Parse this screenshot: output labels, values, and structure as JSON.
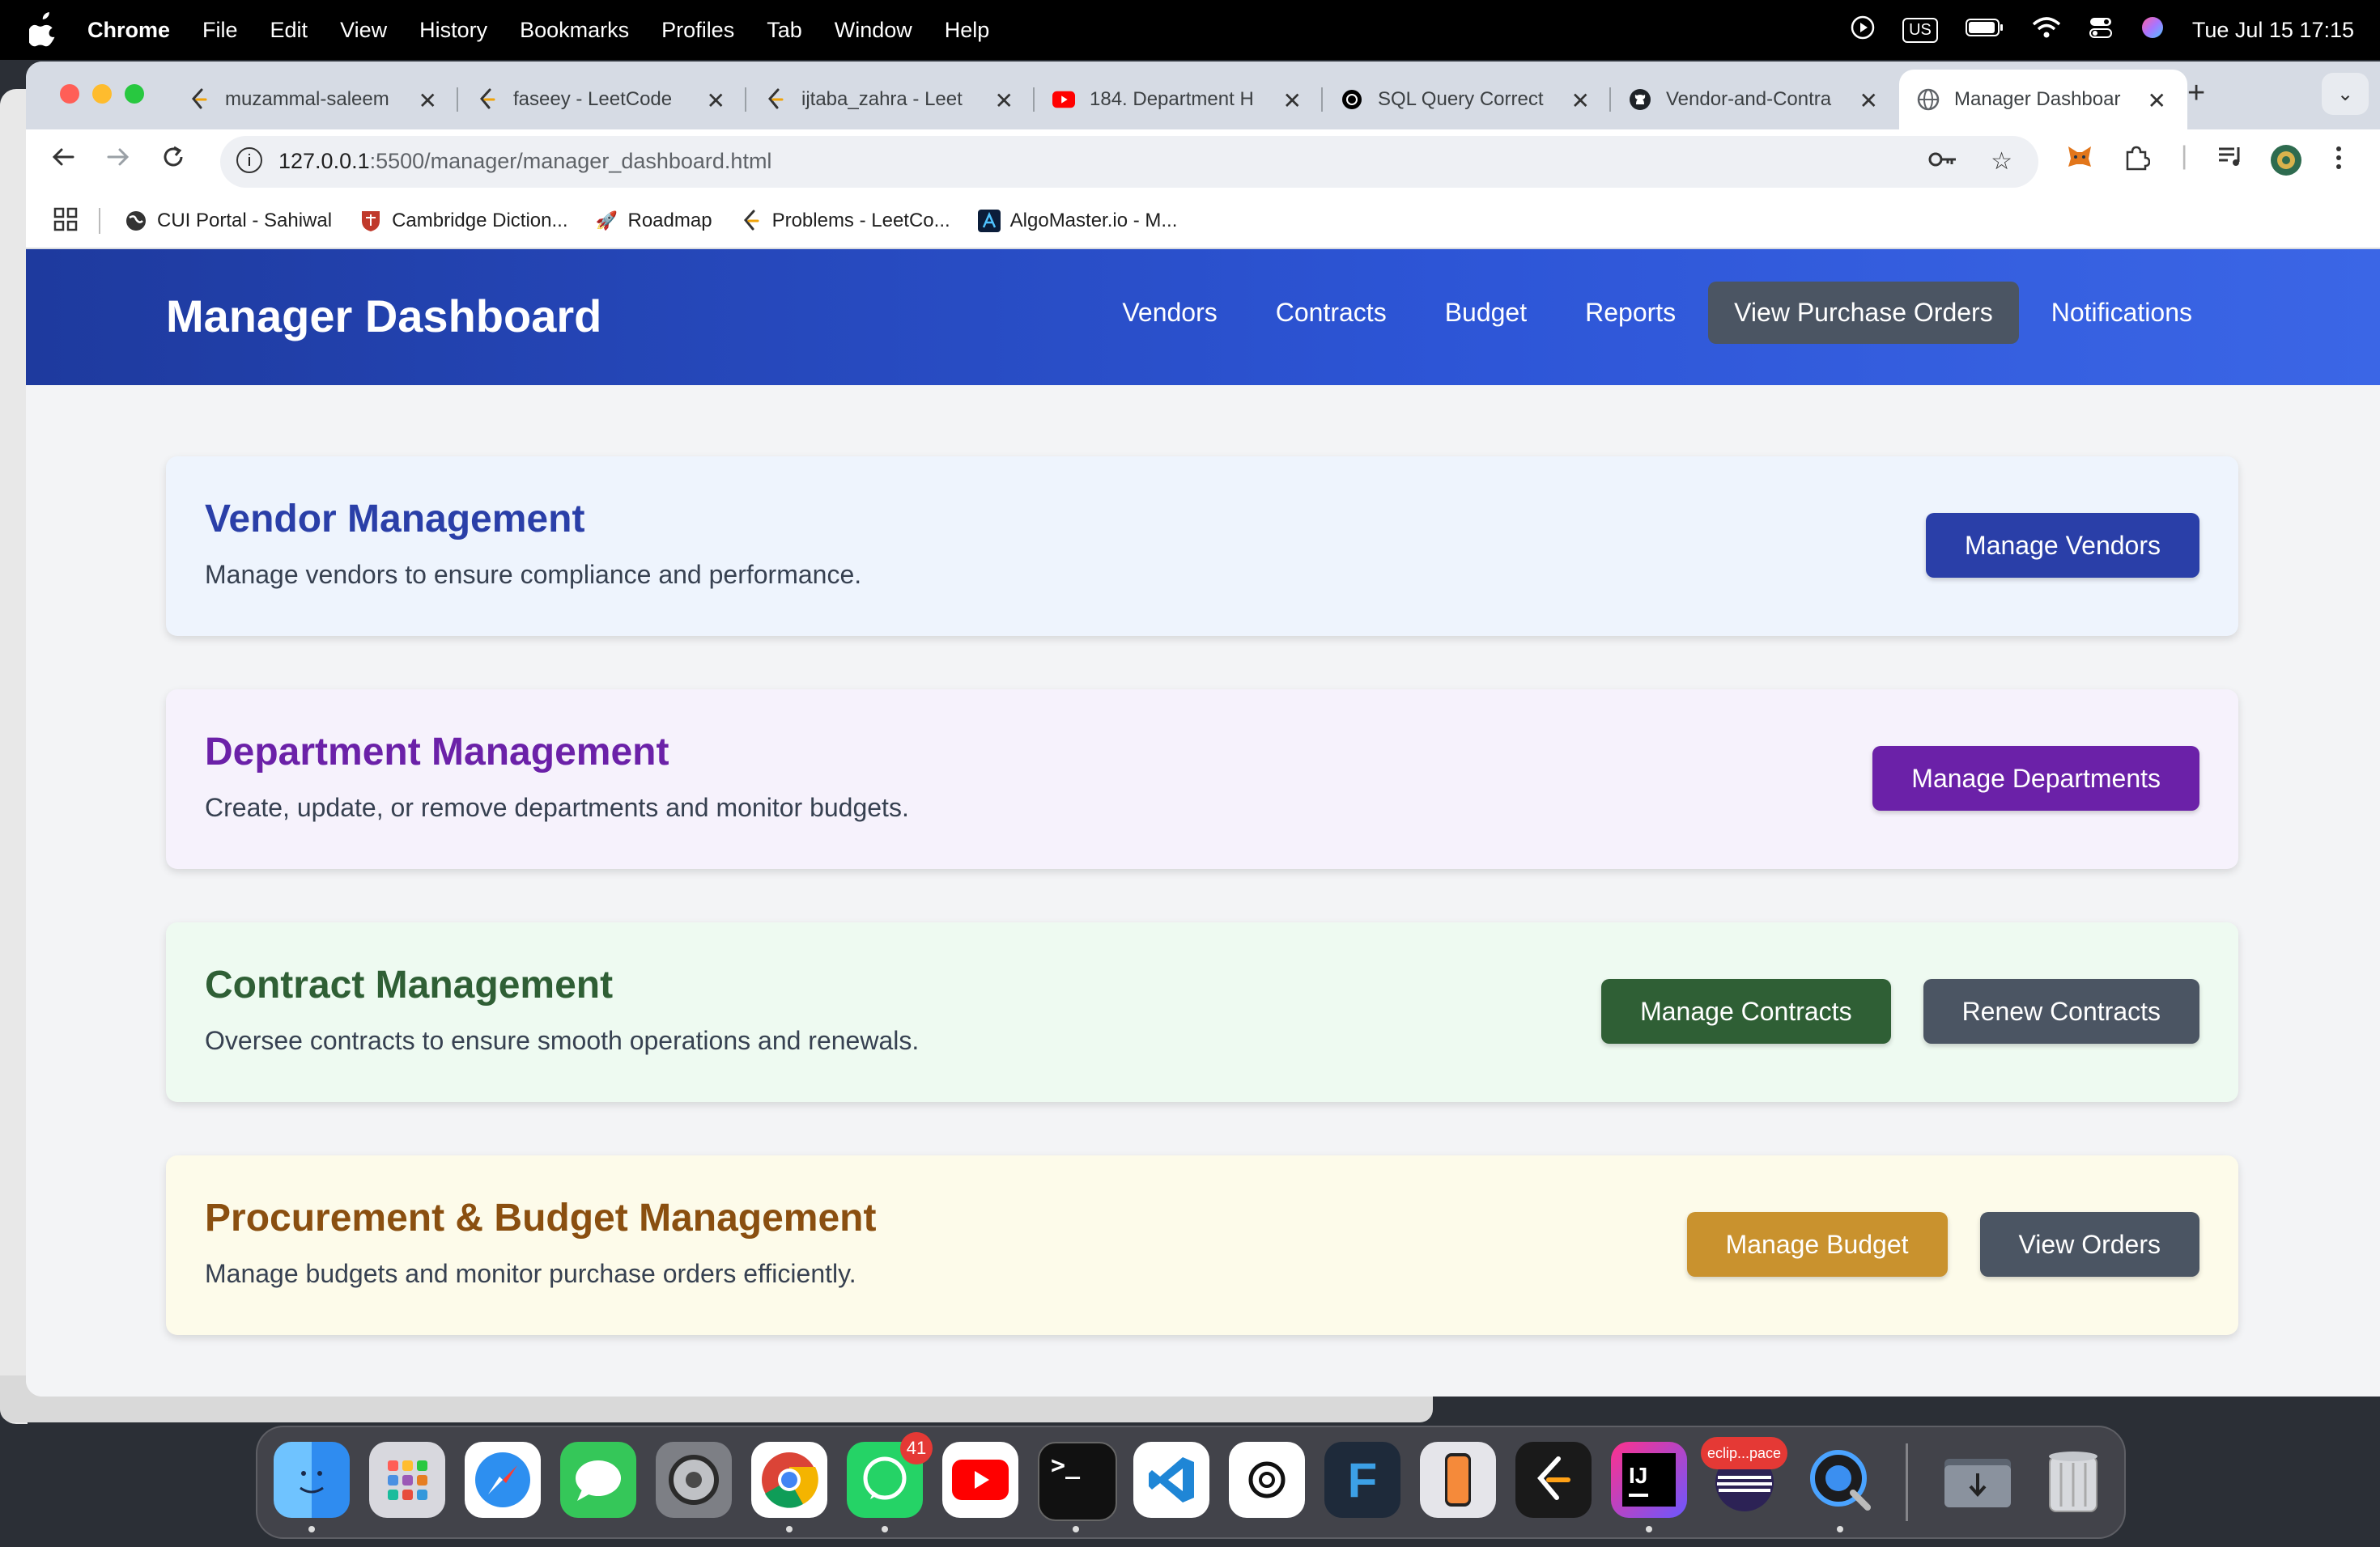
{
  "menubar": {
    "app_name": "Chrome",
    "menus": [
      "File",
      "Edit",
      "View",
      "History",
      "Bookmarks",
      "Profiles",
      "Tab",
      "Window",
      "Help"
    ],
    "input_source": "US",
    "clock": "Tue Jul 15  17:15"
  },
  "browser": {
    "tabs": [
      {
        "title": "muzammal-saleem",
        "icon": "leetcode-icon"
      },
      {
        "title": "faseey - LeetCode",
        "icon": "leetcode-icon"
      },
      {
        "title": "ijtaba_zahra - Leet",
        "icon": "leetcode-icon"
      },
      {
        "title": "184. Department H",
        "icon": "youtube-icon"
      },
      {
        "title": "SQL Query Correct",
        "icon": "chatgpt-icon"
      },
      {
        "title": "Vendor-and-Contra",
        "icon": "github-icon"
      },
      {
        "title": "Manager Dashboar",
        "icon": "globe-icon"
      }
    ],
    "active_tab_index": 6,
    "url_host": "127.0.0.1",
    "url_rest": ":5500/manager/manager_dashboard.html",
    "bookmarks": [
      {
        "label": "CUI Portal - Sahiwal",
        "icon": "globe-icon"
      },
      {
        "label": "Cambridge Diction...",
        "icon": "cambridge-icon"
      },
      {
        "label": "Roadmap",
        "icon": "rocket-icon"
      },
      {
        "label": "Problems - LeetCo...",
        "icon": "leetcode-icon"
      },
      {
        "label": "AlgoMaster.io - M...",
        "icon": "algomaster-icon"
      }
    ]
  },
  "page": {
    "brand": "Manager Dashboard",
    "nav": [
      "Vendors",
      "Contracts",
      "Budget",
      "Reports",
      "View Purchase Orders",
      "Notifications"
    ],
    "active_nav": "View Purchase Orders",
    "cards": [
      {
        "title": "Vendor Management",
        "description": "Manage vendors to ensure compliance and performance.",
        "bg": "#eef4fd",
        "title_color": "#2a3fa8",
        "buttons": [
          {
            "label": "Manage Vendors",
            "color": "#2a3fa8"
          }
        ]
      },
      {
        "title": "Department Management",
        "description": "Create, update, or remove departments and monitor budgets.",
        "bg": "#f6f2fc",
        "title_color": "#6b21a8",
        "buttons": [
          {
            "label": "Manage Departments",
            "color": "#6b21a8"
          }
        ]
      },
      {
        "title": "Contract Management",
        "description": "Oversee contracts to ensure smooth operations and renewals.",
        "bg": "#eefaf1",
        "title_color": "#2f5f35",
        "buttons": [
          {
            "label": "Manage Contracts",
            "color": "#2f5f35"
          },
          {
            "label": "Renew Contracts",
            "color": "#4b5563"
          }
        ]
      },
      {
        "title": "Procurement & Budget Management",
        "description": "Manage budgets and monitor purchase orders efficiently.",
        "bg": "#fdfbea",
        "title_color": "#8a4f10",
        "buttons": [
          {
            "label": "Manage Budget",
            "color": "#c9922e"
          },
          {
            "label": "View Orders",
            "color": "#4b5563"
          }
        ]
      }
    ]
  },
  "dock": {
    "apps": [
      "Finder",
      "Launchpad",
      "Safari",
      "Messages",
      "System Settings",
      "Chrome",
      "WhatsApp",
      "YouTube",
      "Terminal",
      "VS Code",
      "ChatGPT",
      "Figma",
      "iPhone Mirroring",
      "LeetCode",
      "IntelliJ IDEA",
      "Eclipse",
      "QuickTime",
      "Downloads",
      "Trash"
    ],
    "whatsapp_badge": "41",
    "eclipse_label": "eclip...pace"
  }
}
